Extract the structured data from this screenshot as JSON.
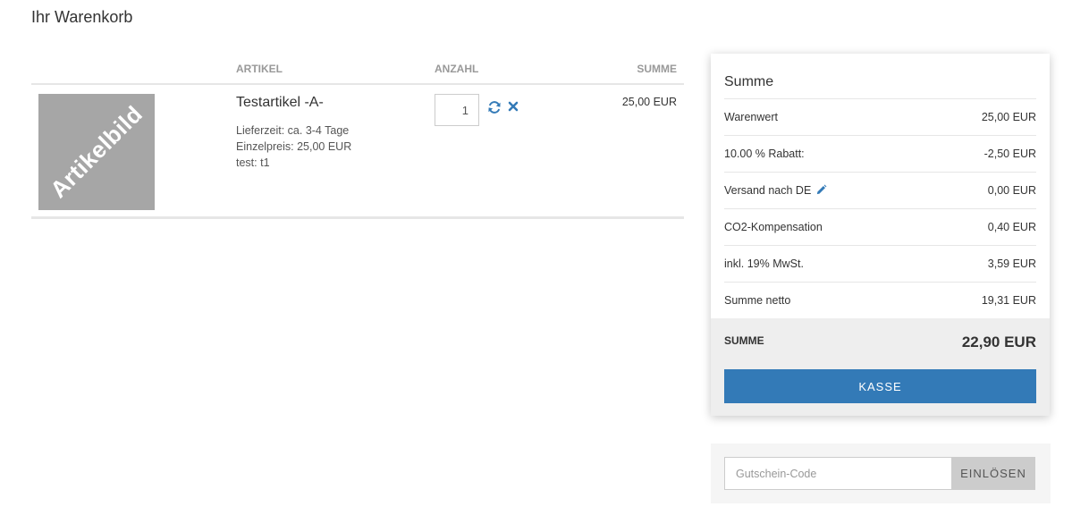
{
  "page": {
    "title": "Ihr Warenkorb"
  },
  "cart": {
    "headers": {
      "artikel": "ARTIKEL",
      "anzahl": "ANZAHL",
      "summe": "SUMME"
    },
    "items": [
      {
        "image_text": "Artikelbild",
        "name": "Testartikel -A-",
        "delivery": "Lieferzeit: ca. 3-4 Tage",
        "unit_price": "Einzelpreis: 25,00 EUR",
        "option": "test: t1",
        "quantity": "1",
        "sum": "25,00 EUR"
      }
    ],
    "icons": {
      "refresh": "refresh-icon",
      "remove": "close-icon"
    }
  },
  "summary": {
    "title": "Summe",
    "lines": [
      {
        "label": "Warenwert",
        "value": "25,00 EUR"
      },
      {
        "label": "10.00 % Rabatt:",
        "value": "-2,50 EUR"
      },
      {
        "label": "Versand nach DE",
        "value": "0,00 EUR"
      },
      {
        "label": "CO2-Kompensation",
        "value": "0,40 EUR"
      },
      {
        "label": "inkl. 19% MwSt.",
        "value": "3,59 EUR"
      },
      {
        "label": "Summe netto",
        "value": "19,31 EUR"
      }
    ],
    "total_label": "SUMME",
    "total_value": "22,90 EUR",
    "checkout_label": "KASSE"
  },
  "voucher": {
    "placeholder": "Gutschein-Code",
    "value": "",
    "redeem_label": "EINLÖSEN"
  },
  "colors": {
    "primary": "#337ab7",
    "image_placeholder": "#a6a6a6",
    "header_text": "#999999"
  }
}
